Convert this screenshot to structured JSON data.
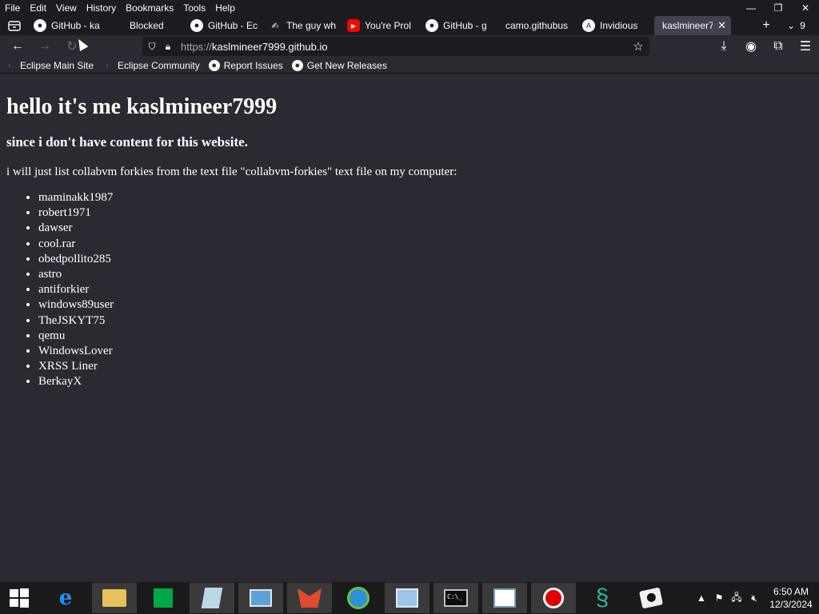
{
  "menu": [
    "File",
    "Edit",
    "View",
    "History",
    "Bookmarks",
    "Tools",
    "Help"
  ],
  "window_controls": {
    "minimize": "—",
    "restore": "❐",
    "close": "✕"
  },
  "tabs": [
    {
      "label": "GitHub - ka",
      "icon": "github-icon"
    },
    {
      "label": "Blocked",
      "icon": ""
    },
    {
      "label": "GitHub - Ec",
      "icon": "github-icon"
    },
    {
      "label": "The guy wh",
      "icon": "page-icon"
    },
    {
      "label": "You're Prol",
      "icon": "youtube-icon"
    },
    {
      "label": "GitHub - g",
      "icon": "github-icon"
    },
    {
      "label": "camo.githubus",
      "icon": ""
    },
    {
      "label": "Invidious",
      "icon": "invidious-icon"
    },
    {
      "label": "kaslmineer7",
      "icon": "",
      "active": true
    }
  ],
  "tab_overflow_count": "9",
  "url": {
    "scheme": "https://",
    "host": "kaslmineer7999.github.io"
  },
  "bookmarks": [
    {
      "label": "Eclipse Main Site",
      "icon": "eclipse-icon"
    },
    {
      "label": "Eclipse Community",
      "icon": "eclipse-icon"
    },
    {
      "label": "Report Issues",
      "icon": "github-icon"
    },
    {
      "label": "Get New Releases",
      "icon": "github-icon"
    }
  ],
  "page": {
    "heading": "hello it's me kaslmineer7999",
    "subheading": "since i don't have content for this website.",
    "intro": "i will just list collabvm forkies from the text file \"collabvm-forkies\" text file on my computer:",
    "forkies": [
      "maminakk1987",
      "robert1971",
      "dawser",
      "cool.rar",
      "obedpollito285",
      "astro",
      "antiforkier",
      "windows89user",
      "TheJSKYT75",
      "qemu",
      "WindowsLover",
      "XRSS Liner",
      "BerkayX"
    ]
  },
  "clock": {
    "time": "6:50 AM",
    "date": "12/3/2024"
  }
}
